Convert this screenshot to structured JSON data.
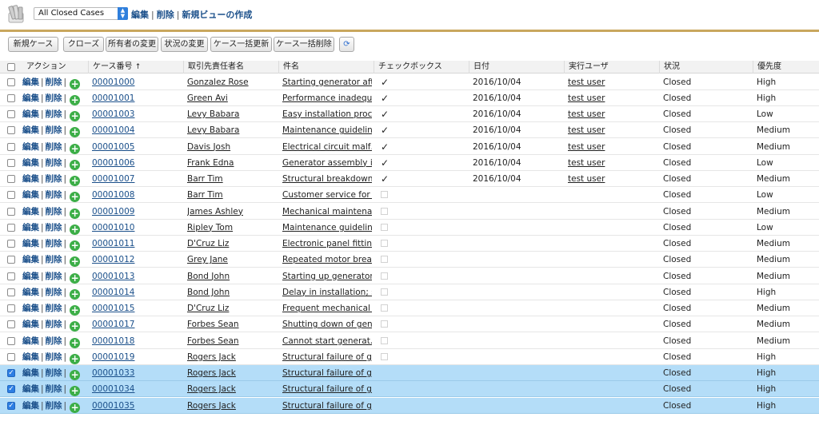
{
  "header": {
    "view_select": "All Closed Cases",
    "links": [
      "編集",
      "削除",
      "新規ビューの作成"
    ]
  },
  "toolbar": {
    "buttons": [
      "新規ケース",
      "クローズ",
      "所有者の変更",
      "状況の変更",
      "ケース一括更新",
      "ケース一括削除"
    ]
  },
  "table": {
    "columns": [
      "アクション",
      "ケース番号",
      "取引先責任者名",
      "件名",
      "チェックボックス",
      "日付",
      "実行ユーザ",
      "状況",
      "優先度"
    ],
    "sort_indicator": "↑",
    "action_edit": "編集",
    "action_delete": "削除",
    "rows": [
      {
        "selected": false,
        "case_no": "00001000",
        "contact": "Gonzalez Rose",
        "subject": "Starting generator aft…",
        "checkbox": true,
        "date": "2016/10/04",
        "user": "test user",
        "status": "Closed",
        "priority": "High"
      },
      {
        "selected": false,
        "case_no": "00001001",
        "contact": "Green Avi",
        "subject": "Performance inadequ…",
        "checkbox": true,
        "date": "2016/10/04",
        "user": "test user",
        "status": "Closed",
        "priority": "High"
      },
      {
        "selected": false,
        "case_no": "00001003",
        "contact": "Levy Babara",
        "subject": "Easy installation proc…",
        "checkbox": true,
        "date": "2016/10/04",
        "user": "test user",
        "status": "Closed",
        "priority": "Low"
      },
      {
        "selected": false,
        "case_no": "00001004",
        "contact": "Levy Babara",
        "subject": "Maintenance guidelin…",
        "checkbox": true,
        "date": "2016/10/04",
        "user": "test user",
        "status": "Closed",
        "priority": "Medium"
      },
      {
        "selected": false,
        "case_no": "00001005",
        "contact": "Davis Josh",
        "subject": "Electrical circuit malf…",
        "checkbox": true,
        "date": "2016/10/04",
        "user": "test user",
        "status": "Closed",
        "priority": "Medium"
      },
      {
        "selected": false,
        "case_no": "00001006",
        "contact": "Frank Edna",
        "subject": "Generator assembly i…",
        "checkbox": true,
        "date": "2016/10/04",
        "user": "test user",
        "status": "Closed",
        "priority": "Low"
      },
      {
        "selected": false,
        "case_no": "00001007",
        "contact": "Barr Tim",
        "subject": "Structural breakdown…",
        "checkbox": true,
        "date": "2016/10/04",
        "user": "test user",
        "status": "Closed",
        "priority": "Medium"
      },
      {
        "selected": false,
        "case_no": "00001008",
        "contact": "Barr Tim",
        "subject": "Customer service for …",
        "checkbox": false,
        "date": "",
        "user": "",
        "status": "Closed",
        "priority": "Low"
      },
      {
        "selected": false,
        "case_no": "00001009",
        "contact": "James Ashley",
        "subject": "Mechanical maintena…",
        "checkbox": false,
        "date": "",
        "user": "",
        "status": "Closed",
        "priority": "Medium"
      },
      {
        "selected": false,
        "case_no": "00001010",
        "contact": "Ripley Tom",
        "subject": "Maintenance guidelin…",
        "checkbox": false,
        "date": "",
        "user": "",
        "status": "Closed",
        "priority": "Low"
      },
      {
        "selected": false,
        "case_no": "00001011",
        "contact": "D'Cruz Liz",
        "subject": "Electronic panel fittin…",
        "checkbox": false,
        "date": "",
        "user": "",
        "status": "Closed",
        "priority": "Medium"
      },
      {
        "selected": false,
        "case_no": "00001012",
        "contact": "Grey Jane",
        "subject": "Repeated motor brea…",
        "checkbox": false,
        "date": "",
        "user": "",
        "status": "Closed",
        "priority": "Medium"
      },
      {
        "selected": false,
        "case_no": "00001013",
        "contact": "Bond John",
        "subject": "Starting up generator…",
        "checkbox": false,
        "date": "",
        "user": "",
        "status": "Closed",
        "priority": "Medium"
      },
      {
        "selected": false,
        "case_no": "00001014",
        "contact": "Bond John",
        "subject": "Delay in installation; s…",
        "checkbox": false,
        "date": "",
        "user": "",
        "status": "Closed",
        "priority": "High"
      },
      {
        "selected": false,
        "case_no": "00001015",
        "contact": "D'Cruz Liz",
        "subject": "Frequent mechanical …",
        "checkbox": false,
        "date": "",
        "user": "",
        "status": "Closed",
        "priority": "Medium"
      },
      {
        "selected": false,
        "case_no": "00001017",
        "contact": "Forbes Sean",
        "subject": "Shutting down of gen…",
        "checkbox": false,
        "date": "",
        "user": "",
        "status": "Closed",
        "priority": "Medium"
      },
      {
        "selected": false,
        "case_no": "00001018",
        "contact": "Forbes Sean",
        "subject": "Cannot start generat…",
        "checkbox": false,
        "date": "",
        "user": "",
        "status": "Closed",
        "priority": "Medium"
      },
      {
        "selected": false,
        "case_no": "00001019",
        "contact": "Rogers Jack",
        "subject": "Structural failure of g…",
        "checkbox": false,
        "date": "",
        "user": "",
        "status": "Closed",
        "priority": "High"
      },
      {
        "selected": true,
        "case_no": "00001033",
        "contact": "Rogers Jack",
        "subject": "Structural failure of g…",
        "checkbox": null,
        "date": "",
        "user": "",
        "status": "Closed",
        "priority": "High"
      },
      {
        "selected": true,
        "case_no": "00001034",
        "contact": "Rogers Jack",
        "subject": "Structural failure of g…",
        "checkbox": null,
        "date": "",
        "user": "",
        "status": "Closed",
        "priority": "High"
      },
      {
        "selected": true,
        "case_no": "00001035",
        "contact": "Rogers Jack",
        "subject": "Structural failure of g…",
        "checkbox": null,
        "date": "",
        "user": "",
        "status": "Closed",
        "priority": "High"
      }
    ]
  },
  "colors": {
    "link": "#1a4f8a",
    "selected_row": "#b4ddf8",
    "accent_line": "#c9a75e",
    "plus_icon": "#3cae47",
    "select_arrow": "#2f7fdc"
  },
  "icons": [
    "books-app-icon",
    "select-arrow-icon",
    "refresh-icon",
    "add-plus-icon",
    "checkmark-icon",
    "sort-ascending-icon"
  ]
}
